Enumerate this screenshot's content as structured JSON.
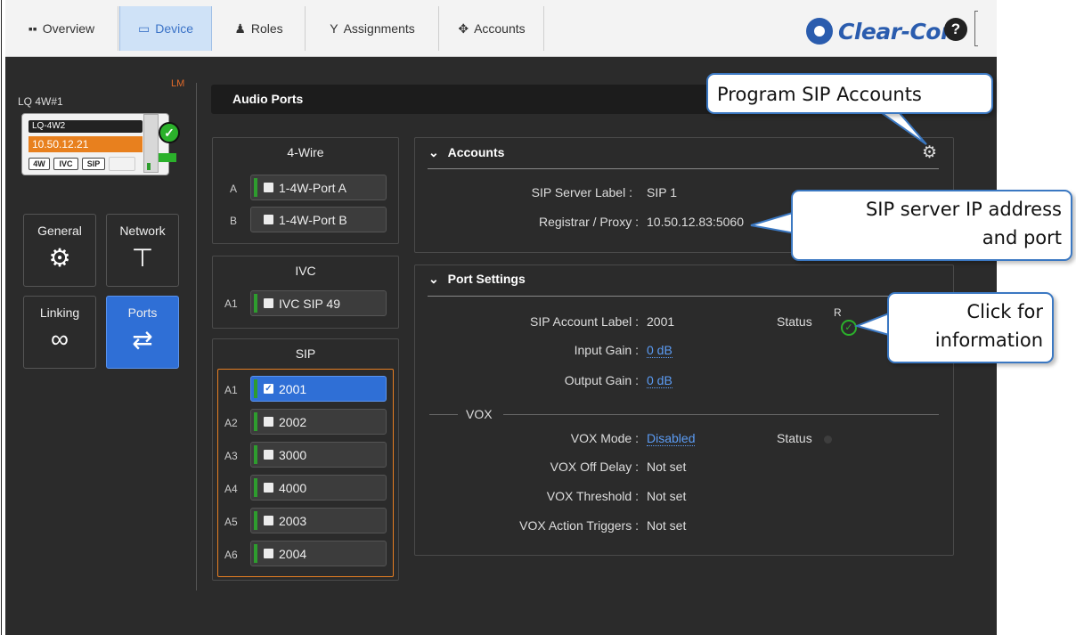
{
  "nav": {
    "tabs": [
      {
        "label": "Overview",
        "icon": "grid-icon"
      },
      {
        "label": "Device",
        "icon": "device-icon"
      },
      {
        "label": "Roles",
        "icon": "roles-icon"
      },
      {
        "label": "Assignments",
        "icon": "assignments-icon"
      },
      {
        "label": "Accounts",
        "icon": "accounts-icon"
      }
    ],
    "active_tab": "Device",
    "logo_text": "Clear-Com",
    "help_label": "?"
  },
  "device": {
    "name": "LQ 4W#1",
    "badge": "LM",
    "card_name": "LQ-4W2",
    "ip": "10.50.12.21",
    "types": [
      "4W",
      "IVC",
      "SIP"
    ]
  },
  "left_nav": [
    {
      "label": "General",
      "icon": "gear-icon"
    },
    {
      "label": "Network",
      "icon": "network-icon"
    },
    {
      "label": "Linking",
      "icon": "link-icon"
    },
    {
      "label": "Ports",
      "icon": "ports-icon"
    }
  ],
  "audio_ports": {
    "title": "Audio Ports",
    "four_wire": {
      "title": "4-Wire",
      "ports": [
        {
          "id": "A",
          "label": "1-4W-Port A"
        },
        {
          "id": "B",
          "label": "1-4W-Port B"
        }
      ]
    },
    "ivc": {
      "title": "IVC",
      "ports": [
        {
          "id": "A1",
          "label": "IVC SIP 49"
        }
      ]
    },
    "sip": {
      "title": "SIP",
      "ports": [
        {
          "id": "A1",
          "label": "2001",
          "selected": true
        },
        {
          "id": "A2",
          "label": "2002"
        },
        {
          "id": "A3",
          "label": "3000"
        },
        {
          "id": "A4",
          "label": "4000"
        },
        {
          "id": "A5",
          "label": "2003"
        },
        {
          "id": "A6",
          "label": "2004"
        }
      ]
    }
  },
  "accounts_panel": {
    "title": "Accounts",
    "sip_server_label_key": "SIP Server Label :",
    "sip_server_label_value": "SIP 1",
    "registrar_key": "Registrar / Proxy :",
    "registrar_value": "10.50.12.83:5060"
  },
  "port_settings": {
    "title": "Port Settings",
    "account_label_key": "SIP Account Label :",
    "account_label_value": "2001",
    "status_label": "Status",
    "status_letter": "R",
    "input_gain_key": "Input Gain :",
    "input_gain_value": "0 dB",
    "output_gain_key": "Output Gain :",
    "output_gain_value": "0 dB",
    "vox_title": "VOX",
    "vox_mode_key": "VOX Mode :",
    "vox_mode_value": "Disabled",
    "vox_status_label": "Status",
    "vox_off_delay_key": "VOX Off Delay :",
    "vox_off_delay_value": "Not set",
    "vox_threshold_key": "VOX Threshold :",
    "vox_threshold_value": "Not set",
    "vox_triggers_key": "VOX Action Triggers :",
    "vox_triggers_value": "Not set"
  },
  "callouts": {
    "program": "Program SIP Accounts",
    "server_line1": "SIP server IP address",
    "server_line2": "and port",
    "click_line1": "Click for",
    "click_line2": "information"
  },
  "colors": {
    "accent_blue": "#2f6fd6",
    "orange": "#e8801e",
    "green": "#2e9c2e",
    "callout_border": "#3b78c2"
  }
}
